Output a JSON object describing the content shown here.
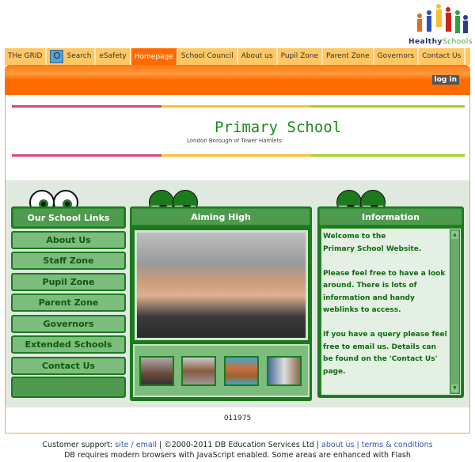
{
  "logo": {
    "word1": "Healthy",
    "word2": "Schools",
    "color1": "#223366",
    "color2": "#3aa040"
  },
  "nav": {
    "tabs": [
      {
        "label": "THe GRID"
      },
      {
        "label": "Search",
        "icon": "search-icon"
      },
      {
        "label": "eSafety"
      },
      {
        "label": "Homepage",
        "active": true
      },
      {
        "label": "School Council"
      },
      {
        "label": "About us"
      },
      {
        "label": "Pupil Zone"
      },
      {
        "label": "Parent Zone"
      },
      {
        "label": "Governors"
      },
      {
        "label": "Contact Us"
      }
    ],
    "active_color": "#ff6a00"
  },
  "login_label": "log in",
  "header": {
    "title": "Primary School",
    "subtitle": "London Borough of Tower Hamlets"
  },
  "links": {
    "title": "Our School Links",
    "items": [
      "About Us",
      "Staff Zone",
      "Pupil Zone",
      "Parent Zone",
      "Governors",
      "Extended Schools",
      "Contact Us"
    ]
  },
  "aiming": {
    "title": "Aiming High"
  },
  "info": {
    "title": "Information",
    "paragraphs": [
      "Welcome to the\nPrimary School Website.",
      "Please feel free to have a look around. There is lots of information and handy weblinks to access.",
      "If you have a query please feel free to email us. Details can be found on the 'Contact Us' page."
    ]
  },
  "counter": "011975",
  "footer": {
    "support": "Customer support:",
    "site": "site",
    "sep": "/",
    "email": "email",
    "copyright": "| ©2000-2011 DB Education Services Ltd |",
    "about": "about us",
    "pipe": "|",
    "terms": "terms & conditions",
    "notice": "DB requires modern browsers with JavaScript enabled. Some areas are enhanced with Flash"
  }
}
